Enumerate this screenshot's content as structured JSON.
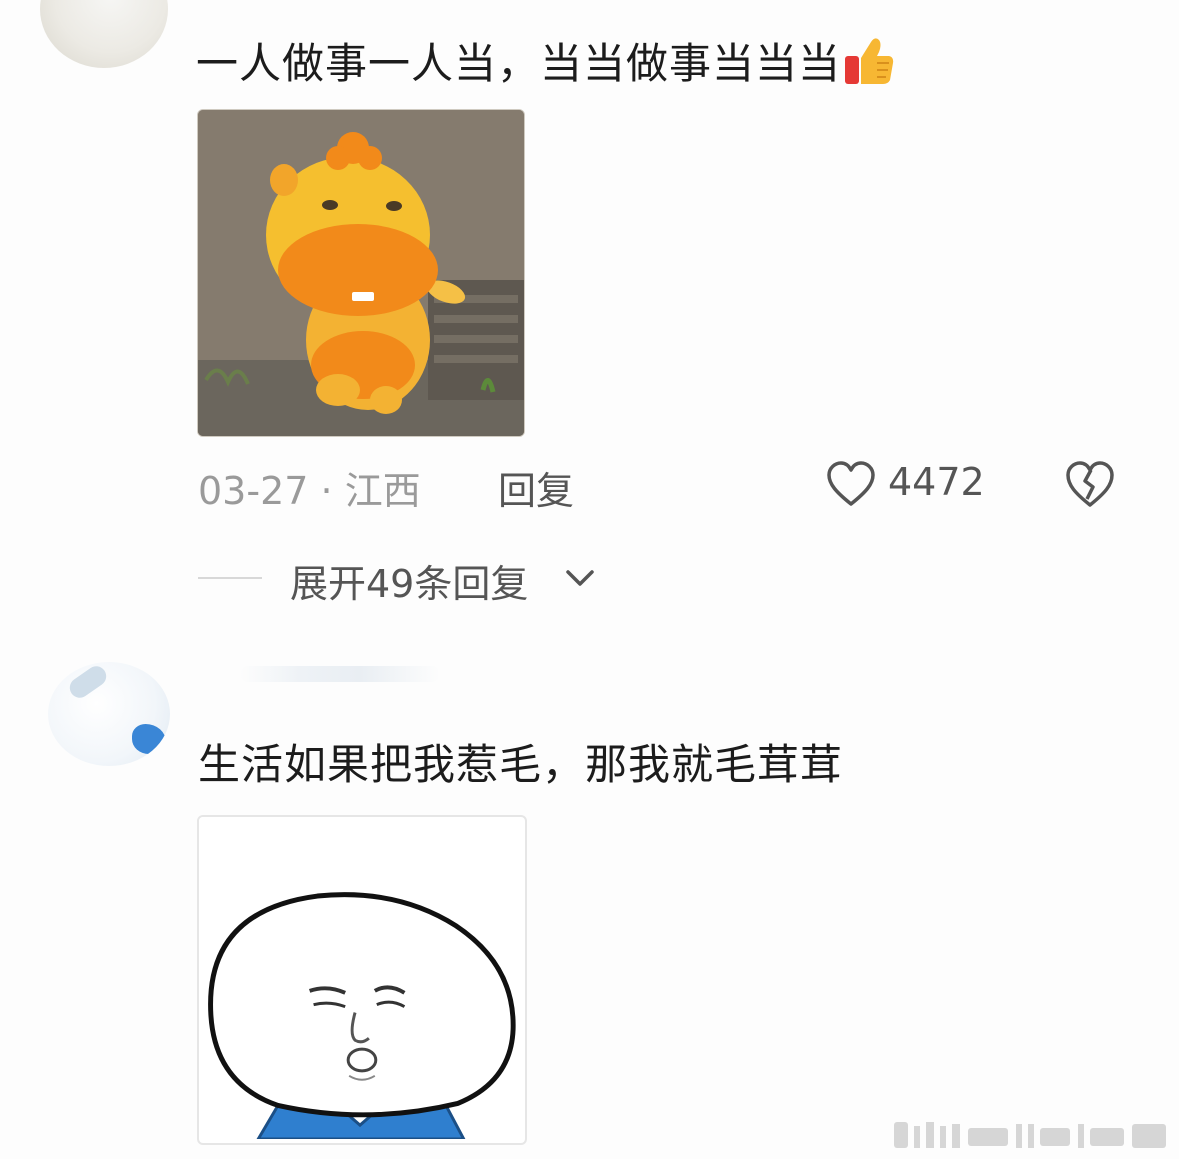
{
  "comments": [
    {
      "text": "一人做事一人当，当当做事当当当",
      "emoji": "thumbs-up-icon",
      "date": "03-27",
      "separator": "·",
      "location": "江西",
      "reply_label": "回复",
      "likes": "4472",
      "expand_label": "展开49条回复"
    },
    {
      "text": "生活如果把我惹毛，那我就毛茸茸"
    }
  ],
  "colors": {
    "text": "#1c1c1c",
    "meta_gray": "#9a9a9a",
    "action_gray": "#555555",
    "thumb_yellow": "#f7b733",
    "thumb_red": "#e53935"
  }
}
